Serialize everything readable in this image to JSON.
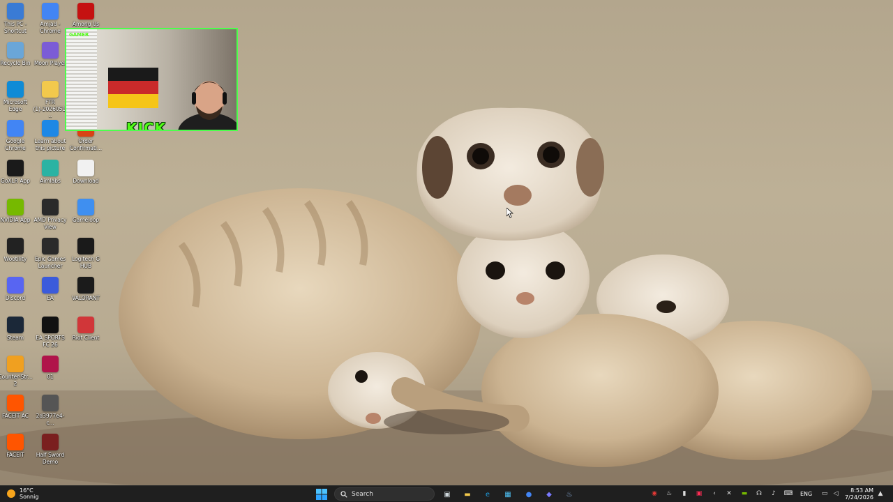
{
  "desktop": {
    "icons": [
      {
        "label": "This PC - Shortcut",
        "icon": "monitor-icon",
        "color": "#3a7bd5"
      },
      {
        "label": "Amjad - Chrome",
        "icon": "chrome-icon",
        "color": "#4285f4"
      },
      {
        "label": "Among Us",
        "icon": "among-us-icon",
        "color": "#c51111"
      },
      {
        "label": "Recycle Bin",
        "icon": "recycle-bin-icon",
        "color": "#6aa6d8"
      },
      {
        "label": "Moon Player",
        "icon": "chrome-icon",
        "color": "#7b5cd6"
      },
      {
        "label": "Microsoft Edge",
        "icon": "edge-icon",
        "color": "#0f8bd6"
      },
      {
        "label": "FTR (1)-2026051...",
        "icon": "folder-icon",
        "color": "#f2c94c"
      },
      {
        "label": "Google Chrome",
        "icon": "chrome-icon",
        "color": "#4285f4"
      },
      {
        "label": "Learn about this picture",
        "icon": "picture-icon",
        "color": "#1e88e5"
      },
      {
        "label": "Order Confirmati...",
        "icon": "document-icon",
        "color": "#d84315"
      },
      {
        "label": "GoXLR App",
        "icon": "goxlr-icon",
        "color": "#1a1a1a"
      },
      {
        "label": "Aimlabs",
        "icon": "aimlabs-icon",
        "color": "#2bb3a3"
      },
      {
        "label": "Download",
        "icon": "chrome-doc-icon",
        "color": "#f1f1f1"
      },
      {
        "label": "NVIDIA App",
        "icon": "nvidia-icon",
        "color": "#76b900"
      },
      {
        "label": "AMD Privacy View",
        "icon": "amd-icon",
        "color": "#2a2a2a"
      },
      {
        "label": "Gameloop",
        "icon": "gameloop-icon",
        "color": "#3f8ff0"
      },
      {
        "label": "Wootility",
        "icon": "wootility-icon",
        "color": "#222"
      },
      {
        "label": "Epic Games Launcher",
        "icon": "epic-icon",
        "color": "#2a2a2a"
      },
      {
        "label": "Logitech G HUB",
        "icon": "logitech-icon",
        "color": "#1a1a1a"
      },
      {
        "label": "Discord",
        "icon": "discord-icon",
        "color": "#5865f2"
      },
      {
        "label": "EA",
        "icon": "ea-icon",
        "color": "#3b5bdb"
      },
      {
        "label": "VALORANT",
        "icon": "valorant-icon",
        "color": "#1b1b1b"
      },
      {
        "label": "Steam",
        "icon": "steam-icon",
        "color": "#1b2838"
      },
      {
        "label": "EA SPORTS FC 26",
        "icon": "fc-icon",
        "color": "#111"
      },
      {
        "label": "Riot Client",
        "icon": "riot-icon",
        "color": "#d13639"
      },
      {
        "label": "Counter-Str... 2",
        "icon": "cs2-icon",
        "color": "#f0a020"
      },
      {
        "label": "01",
        "icon": "record-icon",
        "color": "#b0134a"
      },
      {
        "label": "FACEIT AC",
        "icon": "faceit-ac-icon",
        "color": "#ff5500"
      },
      {
        "label": "2d3977e4-c...",
        "icon": "image-file-icon",
        "color": "#555"
      },
      {
        "label": "FACEIT",
        "icon": "faceit-icon",
        "color": "#ff5500"
      },
      {
        "label": "Half Sword Demo",
        "icon": "half-sword-icon",
        "color": "#7a1f1f"
      }
    ]
  },
  "overlay": {
    "brand": "KICK",
    "small_brand": "GAMER"
  },
  "taskbar": {
    "weather_temp": "16°C",
    "weather_desc": "Sonnig",
    "search_placeholder": "Search",
    "apps": [
      {
        "name": "task-view-icon",
        "glyph": "▣",
        "color": "#cfd8dc"
      },
      {
        "name": "file-explorer-icon",
        "glyph": "▬",
        "color": "#f2c94c"
      },
      {
        "name": "edge-icon",
        "glyph": "e",
        "color": "#1ea2e6"
      },
      {
        "name": "store-icon",
        "glyph": "▦",
        "color": "#4fc3f7"
      },
      {
        "name": "chrome-icon",
        "glyph": "●",
        "color": "#4285f4"
      },
      {
        "name": "app-icon",
        "glyph": "◆",
        "color": "#7a7aff"
      },
      {
        "name": "steam-icon",
        "glyph": "♨",
        "color": "#9ec9ff"
      }
    ],
    "language": "ENG",
    "time": "8:53 AM",
    "date": "7/24/2026"
  }
}
